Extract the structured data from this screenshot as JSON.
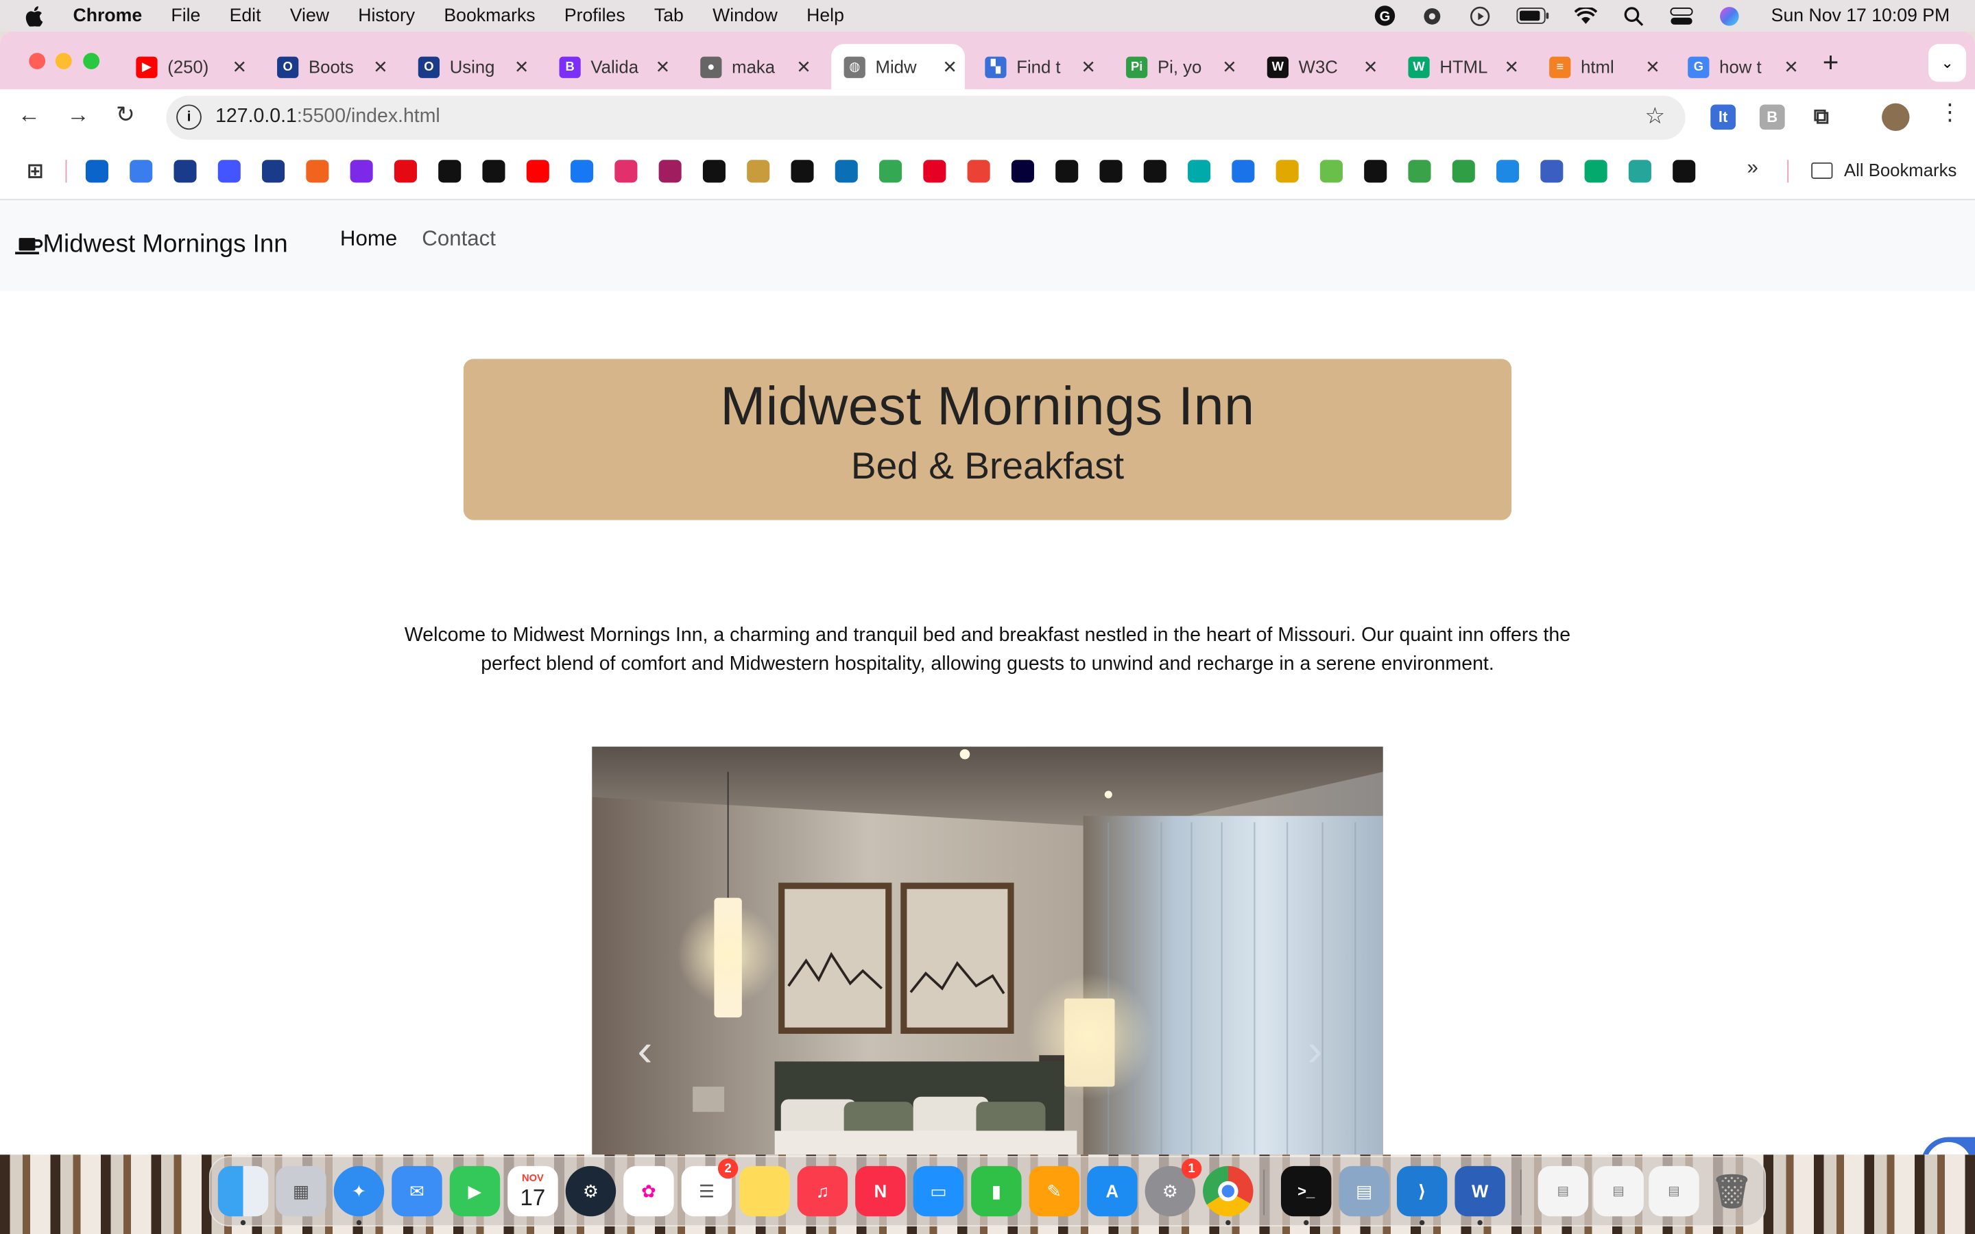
{
  "menubar": {
    "app": "Chrome",
    "items": [
      "File",
      "Edit",
      "View",
      "History",
      "Bookmarks",
      "Profiles",
      "Tab",
      "Window",
      "Help"
    ],
    "clock": "Sun Nov 17  10:09 PM"
  },
  "tabs": [
    {
      "title": "(250)",
      "icon": "youtube-icon",
      "color": "#ff0000",
      "glyph": "▶"
    },
    {
      "title": "Boots",
      "icon": "otc-icon",
      "color": "#1a3a8a",
      "glyph": "O"
    },
    {
      "title": "Using",
      "icon": "otc-icon",
      "color": "#1a3a8a",
      "glyph": "O"
    },
    {
      "title": "Valida",
      "icon": "bootstrap-icon",
      "color": "#7b2ff7",
      "glyph": "B"
    },
    {
      "title": "maka",
      "icon": "github-icon",
      "color": "#666666",
      "glyph": "●"
    },
    {
      "title": "Midw",
      "icon": "globe-icon",
      "color": "#777777",
      "glyph": "◍"
    },
    {
      "title": "Find t",
      "icon": "flag-icon",
      "color": "#3a6fd8",
      "glyph": "▚"
    },
    {
      "title": "Pi, yo",
      "icon": "pi-icon",
      "color": "#2f9e44",
      "glyph": "Pi"
    },
    {
      "title": "W3C",
      "icon": "w3c-icon",
      "color": "#111111",
      "glyph": "W"
    },
    {
      "title": "HTML",
      "icon": "w3schools-icon",
      "color": "#04aa6d",
      "glyph": "W"
    },
    {
      "title": "html",
      "icon": "stackoverflow-icon",
      "color": "#f48024",
      "glyph": "≡"
    },
    {
      "title": "how t",
      "icon": "google-icon",
      "color": "#4285f4",
      "glyph": "G"
    }
  ],
  "active_tab": 5,
  "omnibox": {
    "host": "127.0.0.1",
    "path": ":5500/index.html"
  },
  "bookmarks_more": "»",
  "all_bookmarks": "All Bookmarks",
  "site": {
    "brand": "Midwest Mornings Inn",
    "nav": {
      "home": "Home",
      "contact": "Contact"
    },
    "hero_title": "Midwest Mornings Inn",
    "hero_subtitle": "Bed & Breakfast",
    "welcome": "Welcome to Midwest Mornings Inn, a charming and tranquil bed and breakfast nestled in the heart of Missouri. Our quaint inn offers the perfect blend of comfort and Midwestern hospitality, allowing guests to unwind and recharge in a serene environment.",
    "carousel_prev": "‹",
    "carousel_next": "›"
  },
  "dock": {
    "calendar_month": "NOV",
    "calendar_day": "17",
    "reminders_badge": "2",
    "settings_badge": "1"
  }
}
